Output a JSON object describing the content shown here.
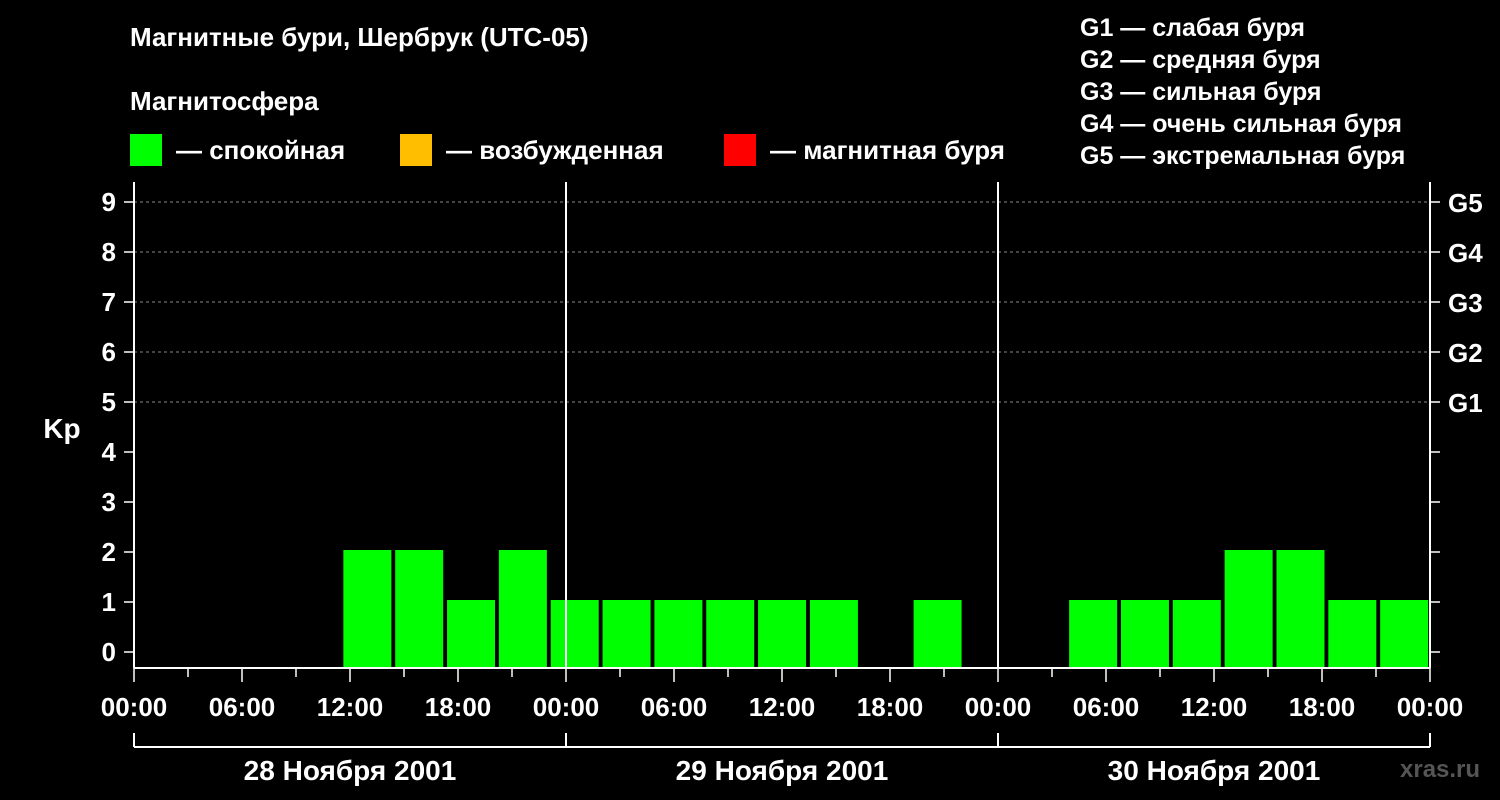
{
  "title": "Магнитные бури, Шербрук (UTC-05)",
  "subtitle": "Магнитосфера",
  "legend": [
    {
      "label": "— спокойная",
      "color": "#00ff00"
    },
    {
      "label": "— возбужденная",
      "color": "#ffbf00"
    },
    {
      "label": "— магнитная буря",
      "color": "#ff0000"
    }
  ],
  "g_legend": [
    "G1 — слабая буря",
    "G2 — средняя буря",
    "G3 — сильная буря",
    "G4 — очень сильная буря",
    "G5 — экстремальная буря"
  ],
  "watermark": "xras.ru",
  "chart_data": {
    "type": "bar",
    "ylabel": "Kp",
    "ylim": [
      0,
      9
    ],
    "yticks": [
      "0",
      "1",
      "2",
      "3",
      "4",
      "5",
      "6",
      "7",
      "8",
      "9"
    ],
    "right_ticks": [
      {
        "kp": 5,
        "label": "G1"
      },
      {
        "kp": 6,
        "label": "G2"
      },
      {
        "kp": 7,
        "label": "G3"
      },
      {
        "kp": 8,
        "label": "G4"
      },
      {
        "kp": 9,
        "label": "G5"
      }
    ],
    "x_tick_labels": [
      "00:00",
      "06:00",
      "12:00",
      "18:00",
      "00:00",
      "06:00",
      "12:00",
      "18:00",
      "00:00",
      "06:00",
      "12:00",
      "18:00",
      "00:00"
    ],
    "days": [
      "28 Ноября 2001",
      "29 Ноября 2001",
      "30 Ноября 2001"
    ],
    "interval_hours": 3,
    "grid": "dashed horizontal at Kp 5-9",
    "bar_color": "#00ff00",
    "values": [
      null,
      null,
      null,
      null,
      2,
      2,
      1,
      2,
      1,
      1,
      1,
      1,
      1,
      1,
      null,
      1,
      null,
      null,
      1,
      1,
      1,
      2,
      2,
      1,
      1
    ]
  }
}
